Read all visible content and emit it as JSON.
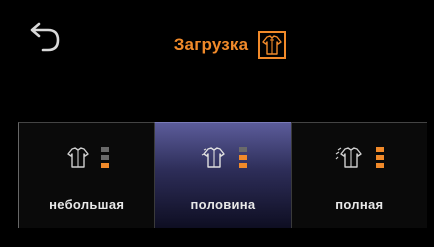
{
  "header": {
    "title": "Загрузка",
    "back_icon": "undo-arrow-icon",
    "title_icon": "laundry-shirt-icon",
    "accent_color": "#f18a2a"
  },
  "options": [
    {
      "label": "небольшая",
      "level": 1,
      "selected": false
    },
    {
      "label": "половина",
      "level": 2,
      "selected": true
    },
    {
      "label": "полная",
      "level": 3,
      "selected": false
    }
  ]
}
